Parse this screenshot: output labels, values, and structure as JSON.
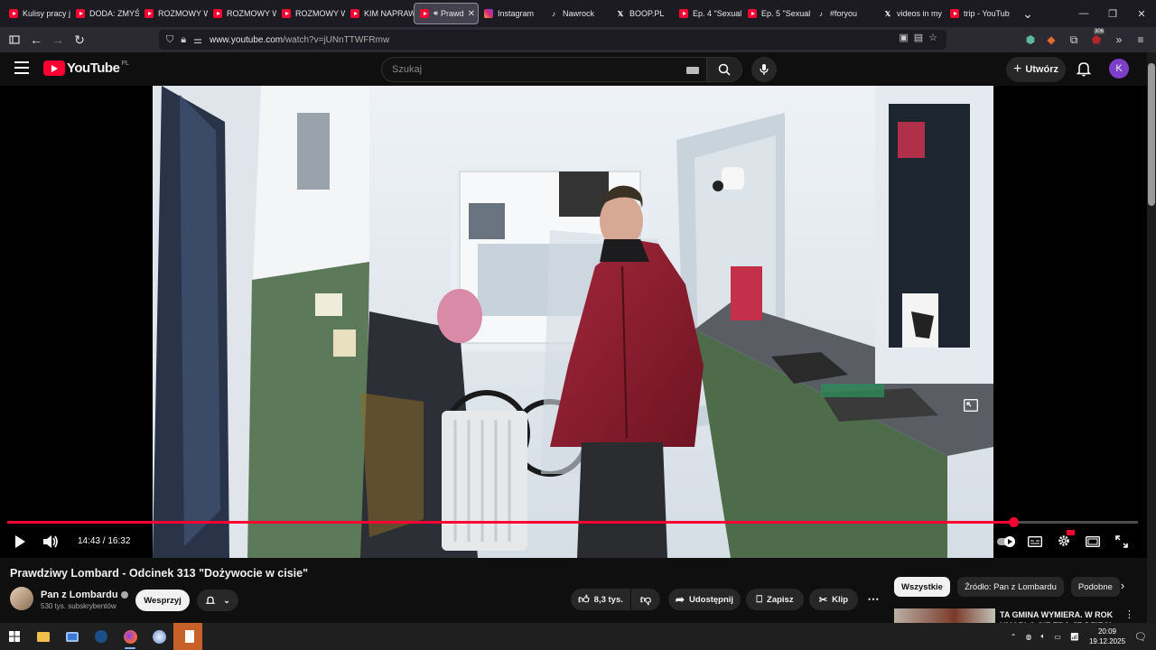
{
  "browser": {
    "tabs": [
      {
        "label": "Kulisy pracy j",
        "icon": "youtube-icon"
      },
      {
        "label": "DODA: ZMYŚ",
        "icon": "youtube-icon"
      },
      {
        "label": "ROZMOWY W",
        "icon": "youtube-icon"
      },
      {
        "label": "ROZMOWY W",
        "icon": "youtube-icon"
      },
      {
        "label": "ROZMOWY W",
        "icon": "youtube-icon"
      },
      {
        "label": "KIM NAPRAW",
        "icon": "youtube-icon"
      },
      {
        "label": "Prawd",
        "icon": "youtube-icon",
        "active": true
      },
      {
        "label": "Instagram",
        "icon": "instagram-icon"
      },
      {
        "label": "Nawrock",
        "icon": "tiktok-icon"
      },
      {
        "label": "BOOP.PL",
        "icon": "x-icon"
      },
      {
        "label": "Ep. 4 \"Sexual",
        "icon": "youtube-icon"
      },
      {
        "label": "Ep. 5 \"Sexual",
        "icon": "youtube-icon"
      },
      {
        "label": "#foryou",
        "icon": "tiktok-icon"
      },
      {
        "label": "videos in my",
        "icon": "x-icon"
      },
      {
        "label": "trip - YouTub",
        "icon": "youtube-icon"
      }
    ],
    "url_host": "www.youtube.com",
    "url_path": "/watch?v=jUNnTTWFRmw",
    "badge_count": "306"
  },
  "youtube": {
    "logo_text": "YouTube",
    "logo_country": "PL",
    "search_placeholder": "Szukaj",
    "create_label": "Utwórz",
    "avatar_letter": "K"
  },
  "player": {
    "current_time": "14:43",
    "duration": "16:32",
    "time_display": "14:43 / 16:32",
    "progress_fraction": 0.89
  },
  "video": {
    "title": "Prawdziwy Lombard - Odcinek 313 \"Dożywocie w cisie\"",
    "channel_name": "Pan z Lombardu",
    "subscribers": "530 tys. subskrybentów",
    "support_label": "Wesprzyj",
    "likes": "8,3 tys.",
    "share_label": "Udostępnij",
    "save_label": "Zapisz",
    "clip_label": "Klip"
  },
  "sidebar": {
    "chips": [
      "Wszystkie",
      "Źródło: Pan z Lombardu",
      "Podobne"
    ],
    "rec_title": "TA GMINA WYMIERA. W ROK UMARŁO SIĘ TRO JE DZIECI"
  },
  "taskbar": {
    "time": "20:09",
    "date": "19.12.2025"
  },
  "colors": {
    "accent": "#ff0033",
    "avatar": "#7e3fc8"
  }
}
